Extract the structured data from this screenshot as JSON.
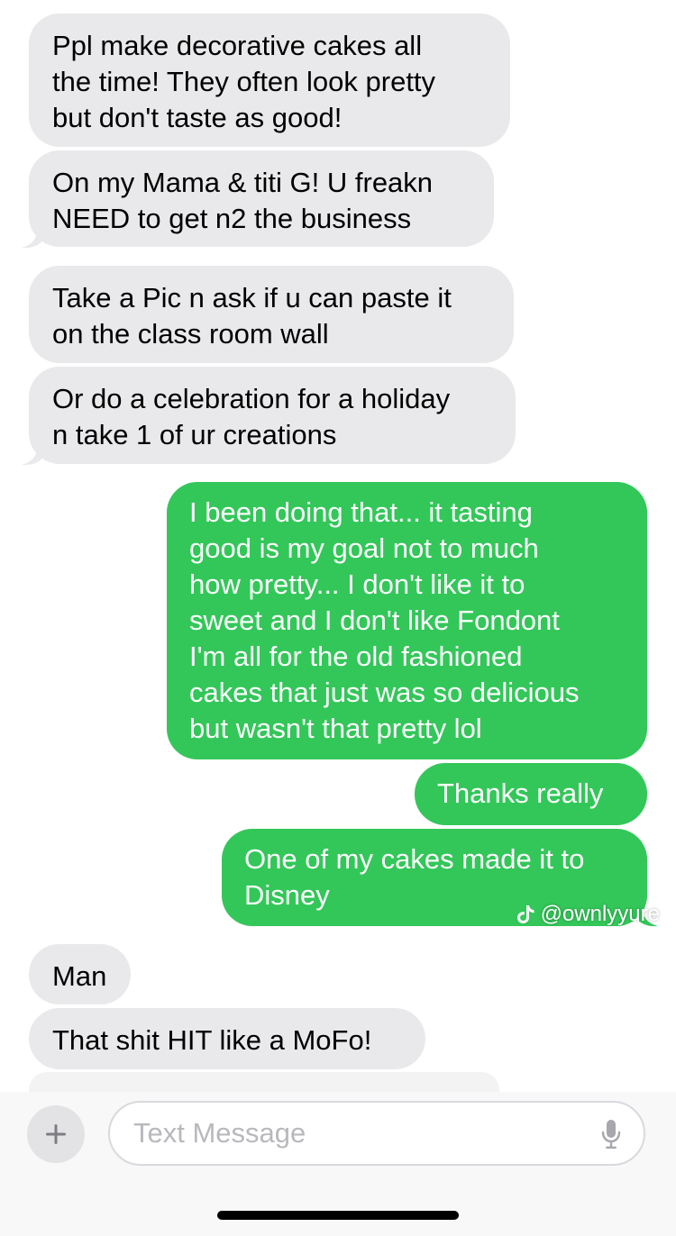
{
  "messages": [
    {
      "direction": "incoming",
      "text": "Ppl make decorative cakes all\nthe time! They often look pretty\nbut don't taste as good!"
    },
    {
      "direction": "incoming",
      "text": "On my Mama & titi G! U freakn\nNEED to get n2 the business"
    },
    {
      "direction": "incoming",
      "text": "Take a Pic n ask if u can paste it\non the class room wall"
    },
    {
      "direction": "incoming",
      "text": "Or do a celebration for a holiday\nn take 1 of ur creations"
    },
    {
      "direction": "outgoing",
      "text": "I been doing that... it tasting\ngood is my goal not to much\nhow pretty... I don't like it to\nsweet and I don't like Fondont\nI'm all for the old fashioned\ncakes that just was so delicious\nbut wasn't that pretty lol"
    },
    {
      "direction": "outgoing",
      "text": "Thanks really"
    },
    {
      "direction": "outgoing",
      "text": "One of my cakes made it to\nDisney"
    },
    {
      "direction": "incoming",
      "text": "Man"
    },
    {
      "direction": "incoming",
      "text": "That shit HIT like a MoFo!"
    }
  ],
  "watermark": {
    "handle": "@ownlyyure",
    "icon": "tiktok-icon"
  },
  "composer": {
    "placeholder": "Text Message",
    "add_icon": "plus-icon",
    "mic_icon": "microphone-icon"
  },
  "colors": {
    "incoming_bubble": "#e9e9eb",
    "outgoing_bubble": "#33c759",
    "incoming_text": "#000000",
    "outgoing_text": "#ffffff"
  }
}
